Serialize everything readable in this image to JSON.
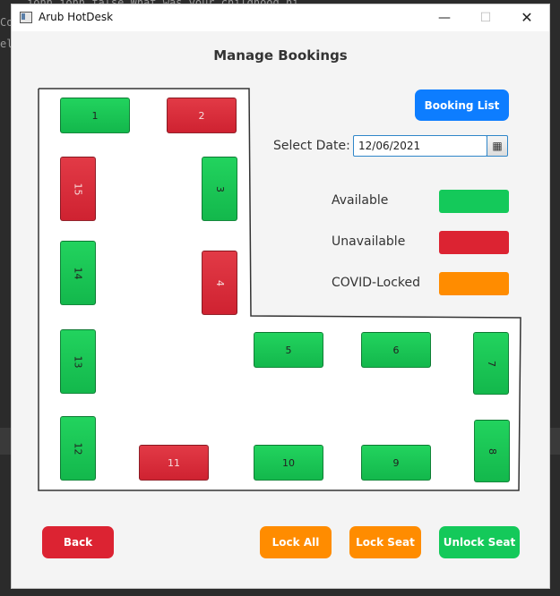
{
  "background_text": {
    "line1": "john          john          false     What was your childhood ni",
    "line2a": "Co",
    "line2b": "el"
  },
  "window": {
    "title": "Arub HotDesk",
    "minimize_icon": "—",
    "maximize_icon": "☐",
    "close_icon": "✕"
  },
  "page": {
    "title": "Manage Bookings"
  },
  "booking_list_label": "Booking List",
  "date": {
    "label": "Select Date:",
    "value": "12/06/2021",
    "calendar_icon": "▦"
  },
  "legend": {
    "available": {
      "label": "Available",
      "color": "#14c95a"
    },
    "unavailable": {
      "label": "Unavailable",
      "color": "#dc2332"
    },
    "covid_locked": {
      "label": "COVID-Locked",
      "color": "#ff8c00"
    }
  },
  "seats": {
    "s1": {
      "label": "1",
      "status": "available"
    },
    "s2": {
      "label": "2",
      "status": "unavailable"
    },
    "s3": {
      "label": "3",
      "status": "available"
    },
    "s4": {
      "label": "4",
      "status": "unavailable"
    },
    "s5": {
      "label": "5",
      "status": "available"
    },
    "s6": {
      "label": "6",
      "status": "available"
    },
    "s7": {
      "label": "7",
      "status": "available"
    },
    "s8": {
      "label": "8",
      "status": "available"
    },
    "s9": {
      "label": "9",
      "status": "available"
    },
    "s10": {
      "label": "10",
      "status": "available"
    },
    "s11": {
      "label": "11",
      "status": "unavailable"
    },
    "s12": {
      "label": "12",
      "status": "available"
    },
    "s13": {
      "label": "13",
      "status": "available"
    },
    "s14": {
      "label": "14",
      "status": "available"
    },
    "s15": {
      "label": "15",
      "status": "unavailable"
    }
  },
  "actions": {
    "back": "Back",
    "lock_all": "Lock All",
    "lock_seat": "Lock Seat",
    "unlock_seat": "Unlock Seat"
  }
}
